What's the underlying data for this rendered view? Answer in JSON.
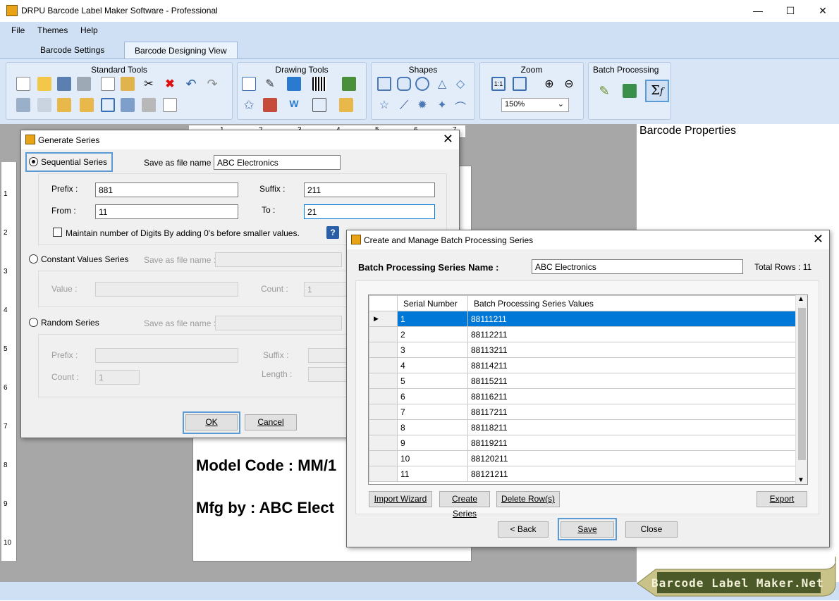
{
  "app": {
    "title": "DRPU Barcode Label Maker Software - Professional"
  },
  "menu": [
    "File",
    "Themes",
    "Help"
  ],
  "tabs": [
    "Barcode Settings",
    "Barcode Designing View"
  ],
  "ribbon": {
    "groups": [
      "Standard Tools",
      "Drawing Tools",
      "Shapes",
      "Zoom",
      "Batch Processing"
    ],
    "zoom_value": "150%"
  },
  "ruler": {
    "h": [
      "1",
      "2",
      "3",
      "4",
      "5",
      "6",
      "7"
    ],
    "v": [
      "1",
      "2",
      "3",
      "4",
      "5",
      "6",
      "7",
      "8",
      "9",
      "10"
    ]
  },
  "label_text": {
    "model": "Model Code : MM/1",
    "mfg": "Mfg by : ABC Elect"
  },
  "properties_title": "Barcode Properties",
  "generate": {
    "title": "Generate Series",
    "sequential": "Sequential Series",
    "save_label": "Save as file name :",
    "save_value": "ABC Electronics",
    "prefix_label": "Prefix :",
    "prefix_value": "881",
    "suffix_label": "Suffix :",
    "suffix_value": "211",
    "from_label": "From :",
    "from_value": "11",
    "to_label": "To :",
    "to_value": "21",
    "maintain": "Maintain number of Digits By adding 0's before smaller values.",
    "constant": "Constant Values Series",
    "save_label2": "Save as file name :",
    "value_label": "Value :",
    "count_label": "Count :",
    "count_value": "1",
    "random": "Random Series",
    "save_label3": "Save as file name :",
    "rprefix_label": "Prefix :",
    "rsuffix_label": "Suffix :",
    "rcount_label": "Count :",
    "rcount_value": "1",
    "length_label": "Length :",
    "ok": "OK",
    "cancel": "Cancel"
  },
  "batch": {
    "title": "Create and Manage Batch Processing Series",
    "name_label": "Batch Processing Series Name :",
    "name_value": "ABC Electronics",
    "total_rows": "Total Rows : 11",
    "col1": "Serial Number",
    "col2": "Batch Processing Series Values",
    "rows": [
      [
        "1",
        "88111211"
      ],
      [
        "2",
        "88112211"
      ],
      [
        "3",
        "88113211"
      ],
      [
        "4",
        "88114211"
      ],
      [
        "5",
        "88115211"
      ],
      [
        "6",
        "88116211"
      ],
      [
        "7",
        "88117211"
      ],
      [
        "8",
        "88118211"
      ],
      [
        "9",
        "88119211"
      ],
      [
        "10",
        "88120211"
      ],
      [
        "11",
        "88121211"
      ]
    ],
    "import": "Import Wizard",
    "create": "Create Series",
    "delete": "Delete Row(s)",
    "export": "Export",
    "back": "< Back",
    "save": "Save",
    "close": "Close"
  },
  "logo": "Barcode Label Maker.Net"
}
